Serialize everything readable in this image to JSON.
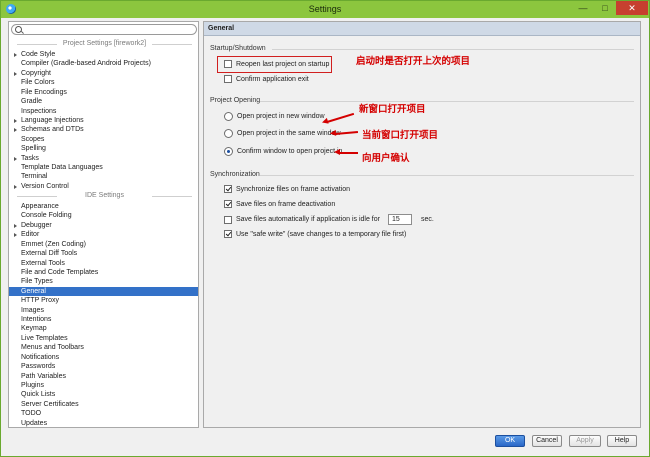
{
  "window": {
    "title": "Settings"
  },
  "search": {
    "placeholder": ""
  },
  "sidebar": {
    "project_settings_title": "Project Settings [firework2]",
    "project_items": [
      {
        "label": "Code Style",
        "has_children": true
      },
      {
        "label": "Compiler (Gradle-based Android Projects)",
        "has_children": false
      },
      {
        "label": "Copyright",
        "has_children": true
      },
      {
        "label": "File Colors",
        "has_children": false
      },
      {
        "label": "File Encodings",
        "has_children": false
      },
      {
        "label": "Gradle",
        "has_children": false
      },
      {
        "label": "Inspections",
        "has_children": false
      },
      {
        "label": "Language Injections",
        "has_children": true
      },
      {
        "label": "Schemas and DTDs",
        "has_children": true
      },
      {
        "label": "Scopes",
        "has_children": false
      },
      {
        "label": "Spelling",
        "has_children": false
      },
      {
        "label": "Tasks",
        "has_children": true
      },
      {
        "label": "Template Data Languages",
        "has_children": false
      },
      {
        "label": "Terminal",
        "has_children": false
      },
      {
        "label": "Version Control",
        "has_children": true
      }
    ],
    "ide_settings_title": "IDE Settings",
    "ide_items": [
      {
        "label": "Appearance",
        "has_children": false
      },
      {
        "label": "Console Folding",
        "has_children": false
      },
      {
        "label": "Debugger",
        "has_children": true
      },
      {
        "label": "Editor",
        "has_children": true
      },
      {
        "label": "Emmet (Zen Coding)",
        "has_children": false
      },
      {
        "label": "External Diff Tools",
        "has_children": false
      },
      {
        "label": "External Tools",
        "has_children": false
      },
      {
        "label": "File and Code Templates",
        "has_children": false
      },
      {
        "label": "File Types",
        "has_children": false
      },
      {
        "label": "General",
        "has_children": false,
        "selected": true
      },
      {
        "label": "HTTP Proxy",
        "has_children": false
      },
      {
        "label": "Images",
        "has_children": false
      },
      {
        "label": "Intentions",
        "has_children": false
      },
      {
        "label": "Keymap",
        "has_children": false
      },
      {
        "label": "Live Templates",
        "has_children": false
      },
      {
        "label": "Menus and Toolbars",
        "has_children": false
      },
      {
        "label": "Notifications",
        "has_children": false
      },
      {
        "label": "Passwords",
        "has_children": false
      },
      {
        "label": "Path Variables",
        "has_children": false
      },
      {
        "label": "Plugins",
        "has_children": false
      },
      {
        "label": "Quick Lists",
        "has_children": false
      },
      {
        "label": "Server Certificates",
        "has_children": false
      },
      {
        "label": "TODO",
        "has_children": false
      },
      {
        "label": "Updates",
        "has_children": false
      }
    ]
  },
  "main": {
    "header": "General",
    "startup": {
      "title": "Startup/Shutdown",
      "reopen_label": "Reopen last project on startup",
      "reopen_checked": false,
      "confirm_exit_label": "Confirm application exit",
      "confirm_exit_checked": false
    },
    "project_opening": {
      "title": "Project Opening",
      "options": [
        {
          "label": "Open project in new window",
          "checked": false
        },
        {
          "label": "Open project in the same window",
          "checked": false
        },
        {
          "label": "Confirm window to open project in",
          "checked": true
        }
      ]
    },
    "sync": {
      "title": "Synchronization",
      "sync_frame_label": "Synchronize files on frame activation",
      "sync_frame_checked": true,
      "save_deactivation_label": "Save files on frame deactivation",
      "save_deactivation_checked": true,
      "save_idle_label": "Save files automatically if application is idle for",
      "save_idle_checked": false,
      "idle_value": "15",
      "idle_unit": "sec.",
      "safe_write_label": "Use \"safe write\" (save changes to a temporary file first)",
      "safe_write_checked": true
    }
  },
  "annotations": {
    "reopen_note": "启动时是否打开上次的项目",
    "new_window_note": "新窗口打开项目",
    "same_window_note": "当前窗口打开项目",
    "confirm_note": "向用户确认",
    "color": "#d40000"
  },
  "footer": {
    "ok": "OK",
    "cancel": "Cancel",
    "apply": "Apply",
    "help": "Help"
  }
}
